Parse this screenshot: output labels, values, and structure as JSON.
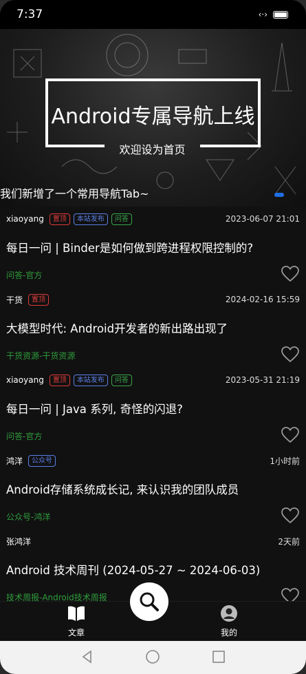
{
  "status_bar": {
    "time": "7:37",
    "icons": [
      "data-arrows-icon",
      "battery-icon"
    ]
  },
  "banner": {
    "title": "Android专属导航上线",
    "subtitle": "欢迎设为首页",
    "caption": "我们新增了一个常用导航Tab~",
    "indicator_color": "#1e6fe6"
  },
  "articles": [
    {
      "author": "xiaoyang",
      "tags": [
        {
          "text": "置顶",
          "color": "red"
        },
        {
          "text": "本站发布",
          "color": "blue"
        },
        {
          "text": "问答",
          "color": "green"
        }
      ],
      "date": "2023-06-07 21:01",
      "title": "每日一问 | Binder是如何做到跨进程权限控制的?",
      "category": "问答-官方"
    },
    {
      "author": "干货",
      "tags": [
        {
          "text": "置顶",
          "color": "red"
        }
      ],
      "date": "2024-02-16 15:59",
      "title": "大模型时代: Android开发者的新出路出现了",
      "category": "干货资源-干货资源"
    },
    {
      "author": "xiaoyang",
      "tags": [
        {
          "text": "置顶",
          "color": "red"
        },
        {
          "text": "本站发布",
          "color": "blue"
        },
        {
          "text": "问答",
          "color": "green"
        }
      ],
      "date": "2023-05-31 21:19",
      "title": "每日一问 | Java 系列, 奇怪的闪退?",
      "category": "问答-官方"
    },
    {
      "author": "鸿洋",
      "tags": [
        {
          "text": "公众号",
          "color": "blue"
        }
      ],
      "date": "1小时前",
      "title": "Android存储系统成长记, 来认识我的团队成员",
      "category": "公众号-鸿洋"
    },
    {
      "author": "张鸿洋",
      "tags": [],
      "date": "2天前",
      "title": "Android 技术周刊 (2024-05-27 ~ 2024-06-03)",
      "category": "技术周报-Android技术周报"
    }
  ],
  "bottom_nav": {
    "articles_label": "文章",
    "mine_label": "我的",
    "fab_icon": "search-icon"
  },
  "colors": {
    "tag_red": "#e03a3a",
    "tag_blue": "#5b7fe8",
    "tag_green": "#3aa84a",
    "category_green": "#2f9c3c"
  }
}
